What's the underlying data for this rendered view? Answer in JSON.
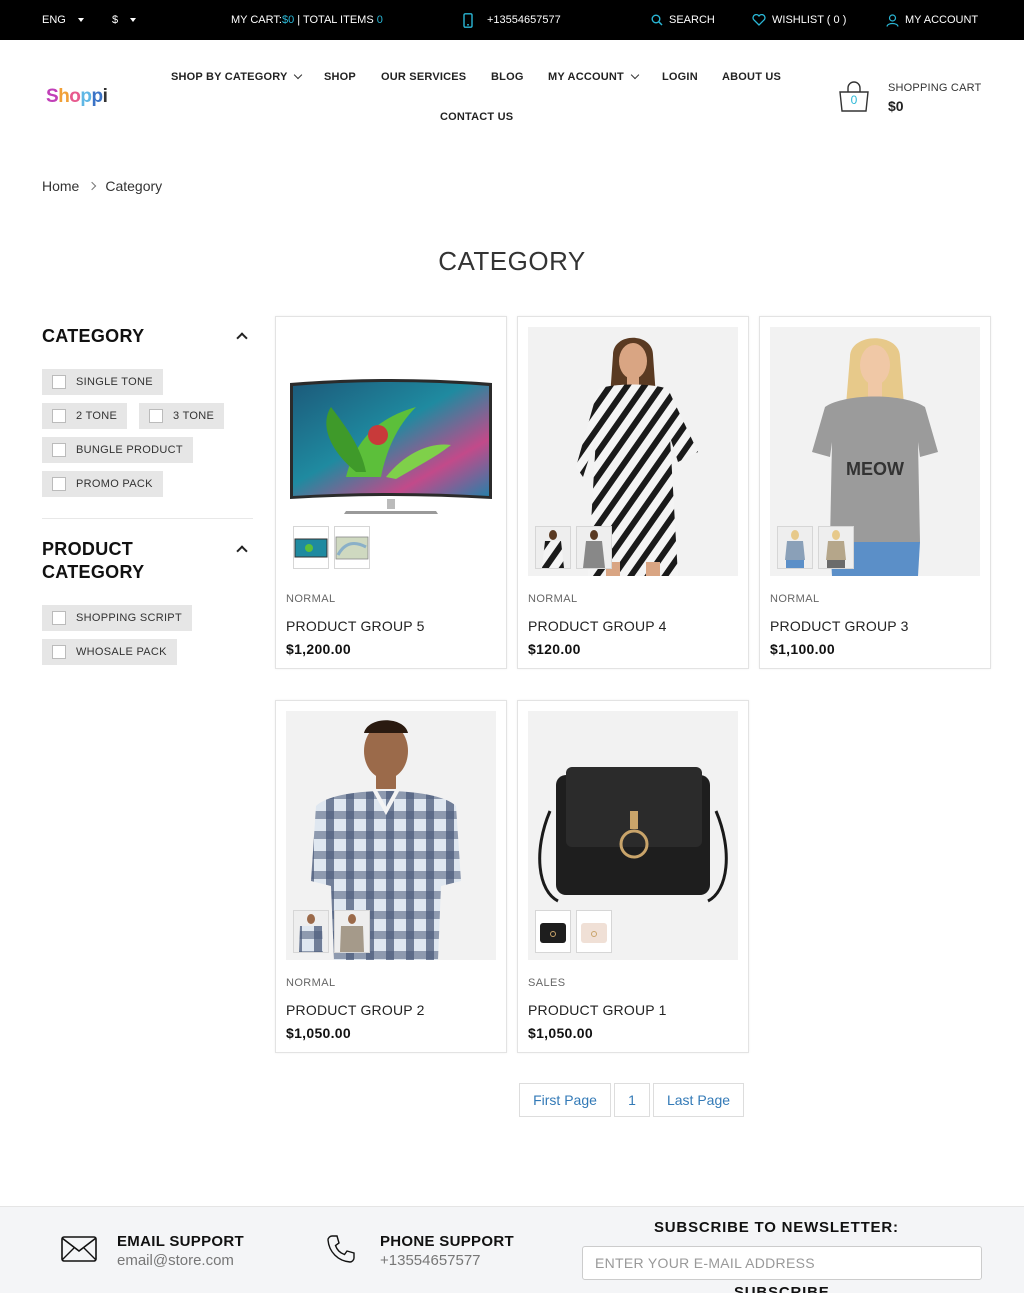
{
  "topbar": {
    "language": "ENG",
    "currency": "$",
    "cart_label": "MY CART: ",
    "cart_amount": "$0",
    "total_items_label": " | TOTAL ITEMS ",
    "total_items_count": "0",
    "phone": "+13554657577",
    "search": "SEARCH",
    "wishlist": "WISHLIST ( 0 )",
    "account": "MY ACCOUNT"
  },
  "header": {
    "logo": {
      "s": "S",
      "h": "h",
      "o1": "o",
      "p1": "p",
      "p2": "p",
      "i": "i"
    },
    "nav": {
      "shop_by_category": "SHOP BY CATEGORY",
      "shop": "SHOP",
      "our_services": "OUR SERVICES",
      "blog": "BLOG",
      "my_account": "MY ACCOUNT",
      "login": "LOGIN",
      "about_us": "ABOUT US",
      "contact_us": "CONTACT US"
    },
    "cart": {
      "count": "0",
      "label": "SHOPPING CART",
      "amount": "$0"
    }
  },
  "breadcrumb": {
    "home": "Home",
    "current": "Category"
  },
  "page_title": "CATEGORY",
  "sidebar": {
    "category_title": "CATEGORY",
    "category_items": [
      "SINGLE TONE",
      "2 TONE",
      "3 TONE",
      "BUNGLE PRODUCT",
      "PROMO PACK"
    ],
    "product_category_title_1": "PRODUCT",
    "product_category_title_2": "CATEGORY",
    "product_category_items": [
      "SHOPPING SCRIPT",
      "WHOSALE PACK"
    ]
  },
  "products": [
    {
      "type": "NORMAL",
      "name": "PRODUCT GROUP 5",
      "price": "$1,200.00"
    },
    {
      "type": "NORMAL",
      "name": "PRODUCT GROUP 4",
      "price": "$120.00"
    },
    {
      "type": "NORMAL",
      "name": "PRODUCT GROUP 3",
      "price": "$1,100.00"
    },
    {
      "type": "NORMAL",
      "name": "PRODUCT GROUP 2",
      "price": "$1,050.00"
    },
    {
      "type": "SALES",
      "name": "PRODUCT GROUP 1",
      "price": "$1,050.00"
    }
  ],
  "pagination": {
    "first": "First Page",
    "page": "1",
    "last": "Last Page"
  },
  "footer": {
    "email_title": "EMAIL SUPPORT",
    "email": "email@store.com",
    "phone_title": "PHONE SUPPORT",
    "phone": "+13554657577",
    "newsletter_title": "SUBSCRIBE TO NEWSLETTER:",
    "newsletter_placeholder": "ENTER YOUR E-MAIL ADDRESS",
    "subscribe": "SUBSCRIBE"
  },
  "colors": {
    "accent": "#2ab7d6",
    "topbar": "#000000",
    "chip": "#e6e6e6",
    "link": "#337ab7"
  }
}
